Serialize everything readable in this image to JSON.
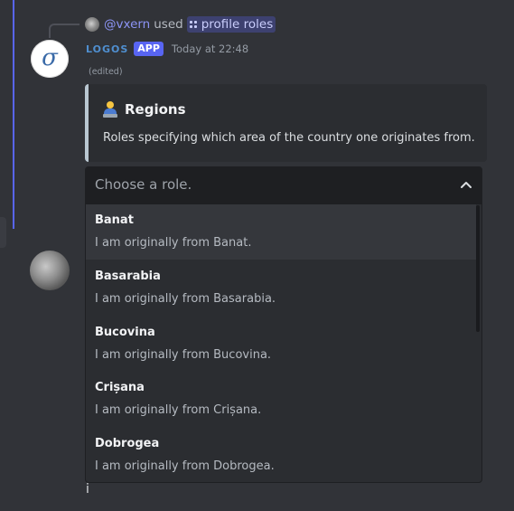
{
  "reply": {
    "user": "@vxern",
    "verb": "used",
    "command": "profile roles"
  },
  "message": {
    "bot_name": "LOGOS",
    "badge": "APP",
    "timestamp": "Today at 22:48",
    "edited": "(edited)"
  },
  "embed": {
    "emoji": "technologist-emoji",
    "title": "Regions",
    "description": "Roles specifying which area of the country one originates from."
  },
  "select": {
    "placeholder": "Choose a role.",
    "options": [
      {
        "label": "Banat",
        "description": "I am originally from Banat."
      },
      {
        "label": "Basarabia",
        "description": "I am originally from Basarabia."
      },
      {
        "label": "Bucovina",
        "description": "I am originally from Bucovina."
      },
      {
        "label": "Crișana",
        "description": "I am originally from Crișana."
      },
      {
        "label": "Dobrogea",
        "description": "I am originally from Dobrogea."
      }
    ]
  },
  "composer": {
    "text": "i"
  },
  "colors": {
    "background": "#313338",
    "accent": "#5865f2",
    "embed_border": "#b9c7d1",
    "bot_name": "#4f8fd0"
  }
}
